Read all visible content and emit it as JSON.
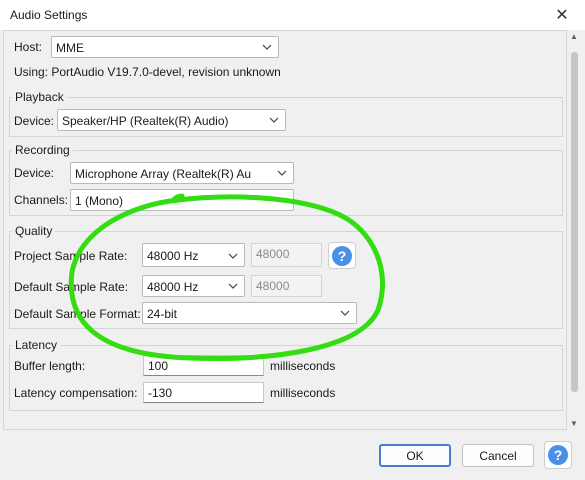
{
  "window": {
    "title": "Audio Settings",
    "close_glyph": "✕"
  },
  "host": {
    "label": "Host:",
    "value": "MME",
    "using_text": "Using: PortAudio V19.7.0-devel, revision unknown"
  },
  "playback": {
    "title": "Playback",
    "device_label": "Device:",
    "device_value": "Speaker/HP (Realtek(R) Audio)"
  },
  "recording": {
    "title": "Recording",
    "device_label": "Device:",
    "device_value": "Microphone Array (Realtek(R) Au",
    "channels_label": "Channels:",
    "channels_value": "1 (Mono)"
  },
  "quality": {
    "title": "Quality",
    "project_rate_label": "Project Sample Rate:",
    "project_rate_value": "48000 Hz",
    "project_rate_custom": "48000",
    "default_rate_label": "Default Sample Rate:",
    "default_rate_value": "48000 Hz",
    "default_rate_custom": "48000",
    "format_label": "Default Sample Format:",
    "format_value": "24-bit",
    "help_glyph": "?"
  },
  "latency": {
    "title": "Latency",
    "buffer_label": "Buffer length:",
    "buffer_value": "100",
    "buffer_unit": "milliseconds",
    "comp_label": "Latency compensation:",
    "comp_value": "-130",
    "comp_unit": "milliseconds"
  },
  "footer": {
    "ok_label": "OK",
    "cancel_label": "Cancel",
    "help_glyph": "?"
  },
  "colors": {
    "annotation": "#33dd11",
    "help_blue": "#4a8fe8"
  },
  "icons": [
    "close-icon",
    "chevron-down-icon",
    "help-icon",
    "scroll-up-icon",
    "scroll-down-icon"
  ]
}
